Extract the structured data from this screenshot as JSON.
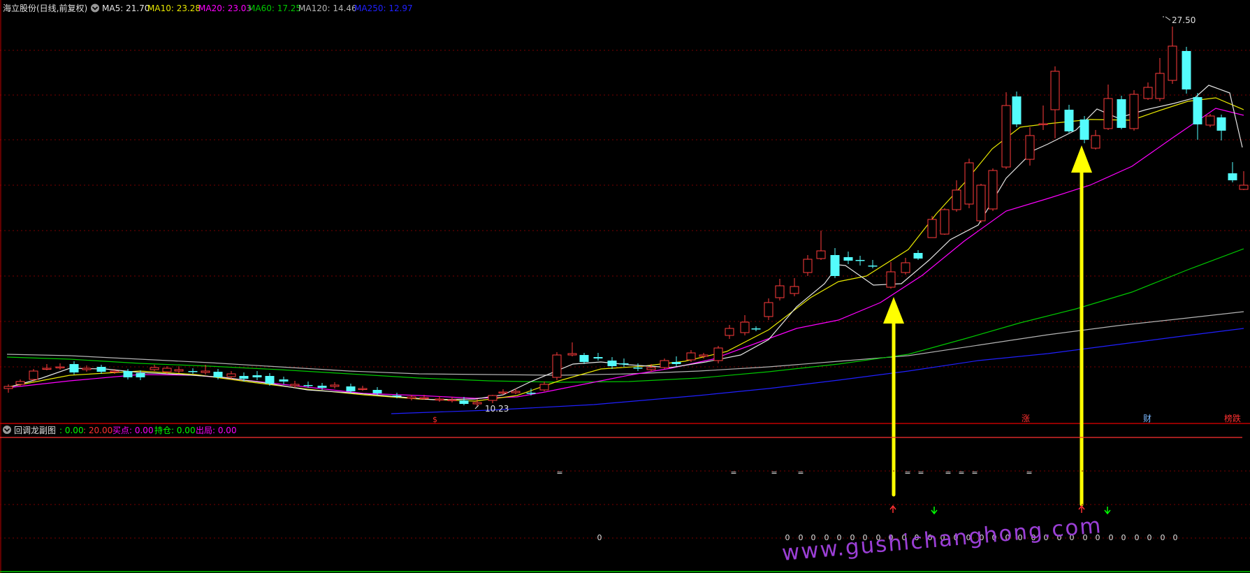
{
  "colors": {
    "bg": "#000000",
    "grid": "#7a0000",
    "frame": "#c00000",
    "up": "#ff3c3c",
    "down": "#54fcfc",
    "ma5": "#e6e6e6",
    "ma10": "#e8e800",
    "ma20": "#ff00ff",
    "ma60": "#00c800",
    "ma120": "#b4b4b4",
    "ma250": "#2020ff",
    "arrow": "#ffff00",
    "sub_zero": "#00ff00",
    "sub_twenty": "#ff3030",
    "buy": "#ff00ff",
    "hold": "#00ff00",
    "exit": "#ff00ff"
  },
  "header": {
    "title": "海立股份(日线,前复权)",
    "ma5": "MA5: 21.70",
    "ma10": "MA10: 23.28",
    "ma20": "MA20: 23.03",
    "ma60": "MA60: 17.25",
    "ma120": "MA120: 14.46",
    "ma250": "MA250: 12.97",
    "icon": "chevron-down-icon"
  },
  "main_chart": {
    "high_label": "27.50",
    "low_label": "10.23",
    "markers": [
      {
        "id": "marker-s",
        "text": "$",
        "color": "#ff3030"
      },
      {
        "id": "marker-zhang",
        "text": "涨",
        "color": "#ff3030"
      },
      {
        "id": "marker-cai",
        "text": "财",
        "color": "#7ab8ff"
      },
      {
        "id": "marker-bangdie",
        "text": "榜跌",
        "color": "#ff3030"
      }
    ]
  },
  "sub_chart": {
    "title": "回调龙副图",
    "value_zero": ": 0.00",
    "value_twenty": ": 20.00",
    "buy": "买点: 0.00",
    "hold": "持仓: 0.00",
    "exit": "出局: 0.00",
    "signal_eq": "=",
    "signal_zero": "0"
  },
  "watermark": "www.gushichanghong.com"
}
